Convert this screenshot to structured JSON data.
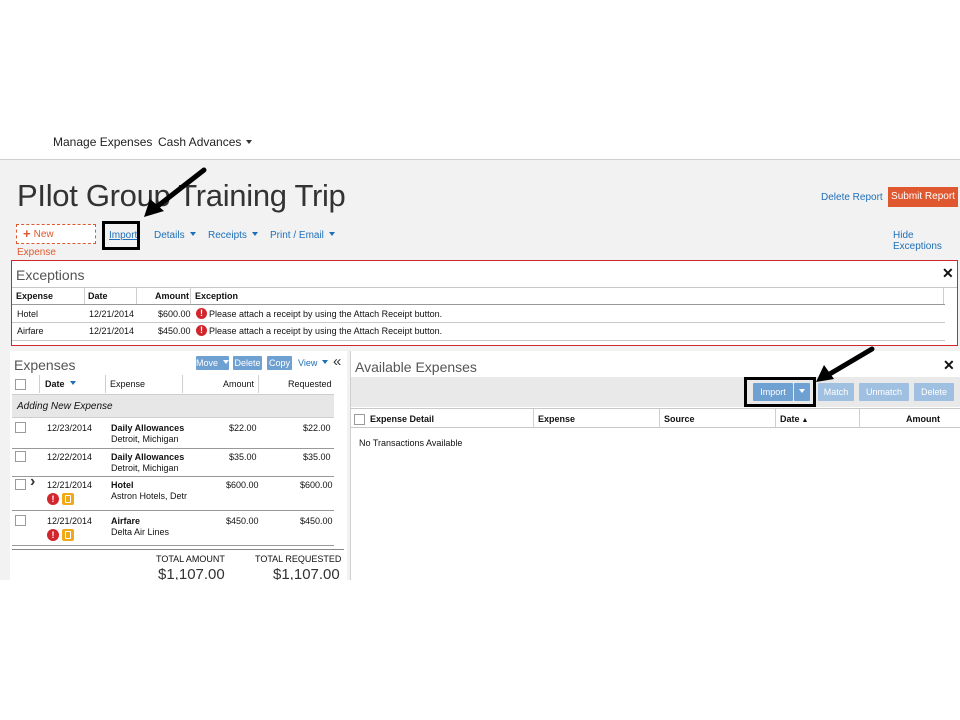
{
  "nav": {
    "manage_expenses": "Manage Expenses",
    "cash_advances": "Cash Advances"
  },
  "report": {
    "title": "PIlot Group Training Trip",
    "delete_report": "Delete Report",
    "submit_report": "Submit Report"
  },
  "actions": {
    "new_expense": "New Expense",
    "import": "Import",
    "details": "Details",
    "receipts": "Receipts",
    "print_email": "Print / Email",
    "hide_exceptions": "Hide Exceptions"
  },
  "exceptions": {
    "title": "Exceptions",
    "columns": {
      "expense": "Expense",
      "date": "Date",
      "amount": "Amount",
      "exception": "Exception"
    },
    "rows": [
      {
        "expense": "Hotel",
        "date": "12/21/2014",
        "amount": "$600.00",
        "exception": "Please attach a receipt by using the Attach Receipt button."
      },
      {
        "expense": "Airfare",
        "date": "12/21/2014",
        "amount": "$450.00",
        "exception": "Please attach a receipt by using the Attach Receipt button."
      }
    ]
  },
  "expenses": {
    "title": "Expenses",
    "buttons": {
      "move": "Move",
      "delete": "Delete",
      "copy": "Copy",
      "view": "View",
      "collapse": "«"
    },
    "columns": {
      "date": "Date",
      "expense": "Expense",
      "amount": "Amount",
      "requested": "Requested"
    },
    "group_label": "Adding New Expense",
    "rows": [
      {
        "date": "12/23/2014",
        "expense": "Daily Allowances",
        "location": "Detroit, Michigan",
        "amount": "$22.00",
        "requested": "$22.00"
      },
      {
        "date": "12/22/2014",
        "expense": "Daily Allowances",
        "location": "Detroit, Michigan",
        "amount": "$35.00",
        "requested": "$35.00"
      },
      {
        "date": "12/21/2014",
        "expense": "Hotel",
        "location": "Astron Hotels, Detr",
        "amount": "$600.00",
        "requested": "$600.00"
      },
      {
        "date": "12/21/2014",
        "expense": "Airfare",
        "location": "Delta Air Lines",
        "amount": "$450.00",
        "requested": "$450.00"
      }
    ],
    "totals": {
      "total_amount_label": "TOTAL AMOUNT",
      "total_requested_label": "TOTAL REQUESTED",
      "total_amount": "$1,107.00",
      "total_requested": "$1,107.00"
    }
  },
  "available": {
    "title": "Available Expenses",
    "buttons": {
      "import": "Import",
      "match": "Match",
      "unmatch": "Unmatch",
      "delete": "Delete"
    },
    "columns": {
      "expense_detail": "Expense Detail",
      "expense": "Expense",
      "source": "Source",
      "date": "Date",
      "amount": "Amount"
    },
    "empty_message": "No Transactions Available"
  },
  "icons": {
    "close": "✕",
    "error": "!",
    "expand": "›"
  },
  "colors": {
    "accent": "#1f6fb8",
    "submit": "#e0582f",
    "error": "#d2262d",
    "warning": "#f0a818",
    "toolbar_button": "#6fa0d2"
  }
}
